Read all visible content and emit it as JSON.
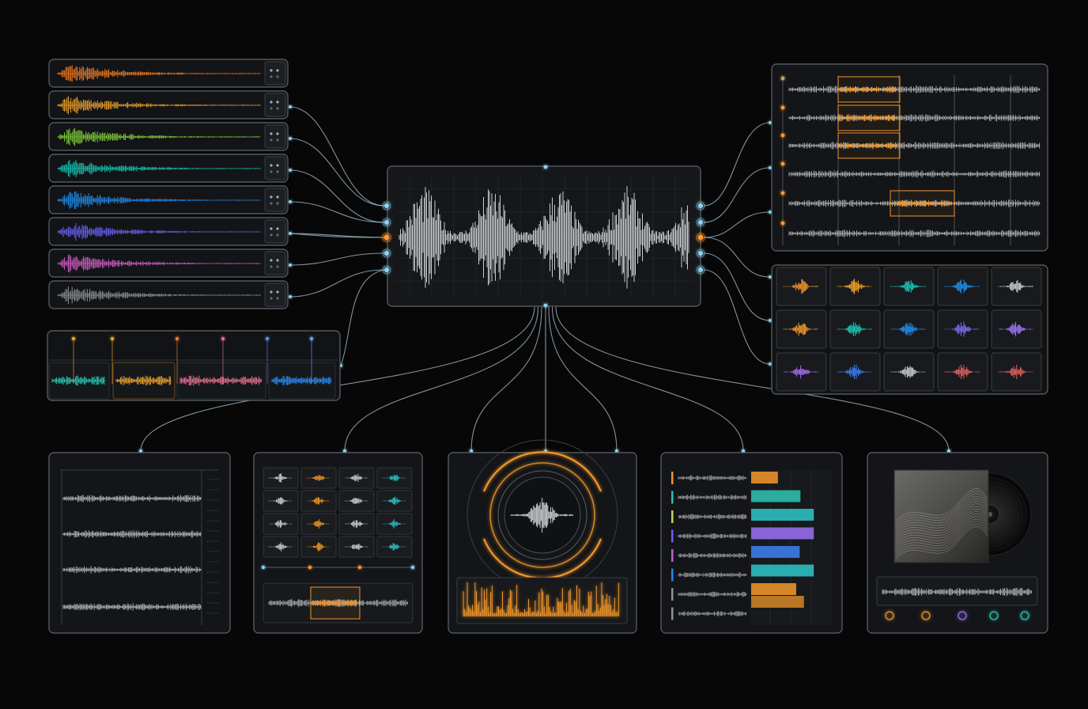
{
  "colors": {
    "background": "#070708",
    "panel_fill": "#17191c",
    "panel_fill_dark": "#0f1012",
    "panel_border": "#5f666d",
    "wire": "#a9c3cf",
    "node_glow": "#8ed4f0",
    "node_active": "#ff9a2e",
    "grid": "#2a2e33",
    "wave_neutral": "#c9cbcd",
    "playhead": "#f0952a"
  },
  "stem_tracks": [
    {
      "name": "stem-orange",
      "color": "#f07a22"
    },
    {
      "name": "stem-amber",
      "color": "#f0a42a"
    },
    {
      "name": "stem-green",
      "color": "#84d23c"
    },
    {
      "name": "stem-teal",
      "color": "#19c7b6"
    },
    {
      "name": "stem-blue",
      "color": "#1f8ff0"
    },
    {
      "name": "stem-indigo",
      "color": "#6a62f2"
    },
    {
      "name": "stem-pink",
      "color": "#d260c4"
    },
    {
      "name": "stem-gray",
      "color": "#8d9195"
    }
  ],
  "clip_strip": {
    "clips": [
      {
        "name": "clip-teal",
        "color": "#2ec1b0"
      },
      {
        "name": "clip-amber",
        "color": "#e8a032"
      },
      {
        "name": "clip-pink",
        "color": "#e06d8e"
      },
      {
        "name": "clip-blue",
        "color": "#2c86ee"
      }
    ],
    "markers": [
      "#f0a42a",
      "#f0a42a",
      "#f07a22",
      "#e06d8e",
      "#5a8cf0",
      "#5aa8f0"
    ]
  },
  "arrangement": {
    "lanes": 6,
    "highlighted_clips": [
      {
        "lane": 1,
        "color": "#f0952a"
      },
      {
        "lane": 2,
        "color": "#f0952a"
      },
      {
        "lane": 3,
        "color": "#f0952a"
      },
      {
        "lane": 5,
        "color": "#f0952a"
      }
    ]
  },
  "sample_grid": {
    "rows": [
      [
        "#f0952a",
        "#f0a42a",
        "#19c7b6",
        "#1f8ff0",
        "#c9cbcd"
      ],
      [
        "#f0952a",
        "#19c7b6",
        "#1f8ff0",
        "#7a6ef2",
        "#9a78f0"
      ],
      [
        "#a56af0",
        "#3f7ef0",
        "#c9cbcd",
        "#e0605a",
        "#e0605a"
      ]
    ]
  },
  "bottom_panels": [
    {
      "name": "multitrack-timeline"
    },
    {
      "name": "pad-sequencer"
    },
    {
      "name": "circular-visualizer"
    },
    {
      "name": "mix-levels"
    },
    {
      "name": "album-output"
    }
  ],
  "pad_sequencer": {
    "columns": [
      "#c9cbcd",
      "#f0952a",
      "#c9cbcd",
      "#2ec1c4"
    ]
  },
  "mix_levels": {
    "levels": [
      {
        "color": "#f0952a",
        "level": 0.38
      },
      {
        "color": "#2ec1b0",
        "level": 0.7
      },
      {
        "color": "#2ec1c4",
        "level": 0.89
      },
      {
        "color": "#9a6ef0",
        "level": 0.89
      },
      {
        "color": "#3f7ef0",
        "level": 0.69
      },
      {
        "color": "#2ec1c4",
        "level": 0.89
      },
      {
        "color": "#f0952a",
        "level": 0.64
      }
    ],
    "tags": [
      "#f0952a",
      "#2ec1b0",
      "#c8d060",
      "#6a62f2",
      "#c060d0",
      "#2c86ee",
      "#8d9195",
      "#8d9195"
    ]
  },
  "output_rings": [
    "#f0952a",
    "#f0952a",
    "#9a6ef0",
    "#2ec1b0",
    "#2ec1b0"
  ]
}
